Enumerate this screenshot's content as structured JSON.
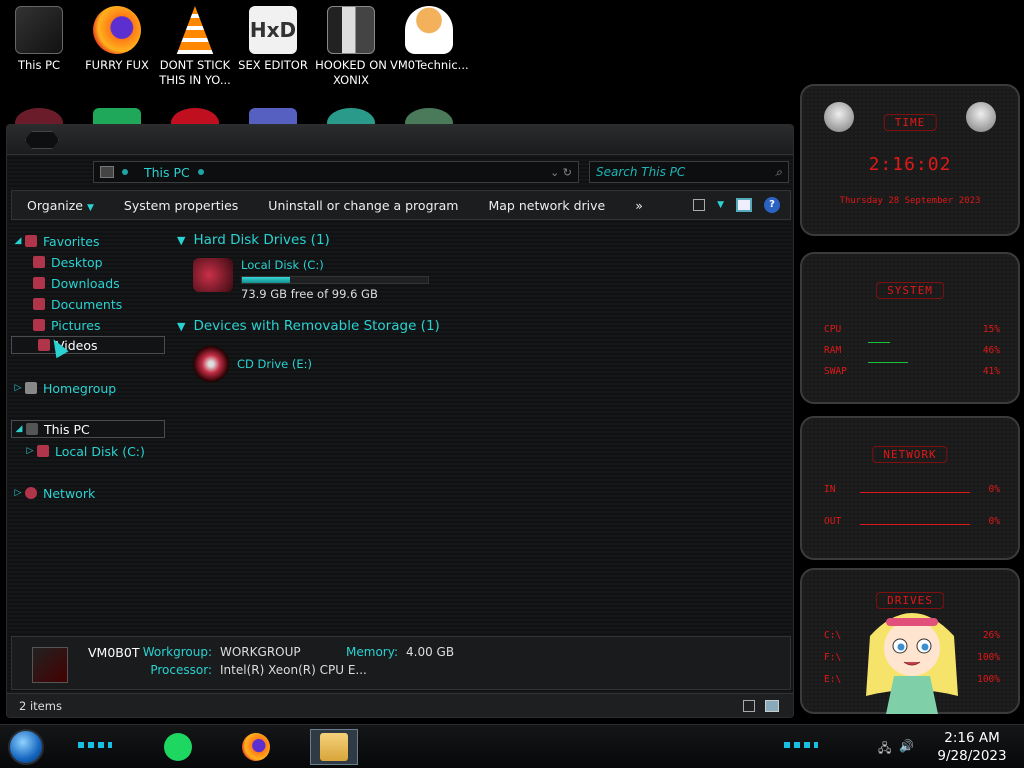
{
  "desktop_icons": [
    {
      "label": "This PC",
      "icon": "computer-icon"
    },
    {
      "label": "FURRY FUX",
      "icon": "firefox-icon"
    },
    {
      "label": "DONT STICK THIS IN YO...",
      "icon": "vlc-cone-icon"
    },
    {
      "label": "SEX EDITOR",
      "icon": "hxd-editor-icon"
    },
    {
      "label": "HOOKED ON XONIX",
      "icon": "xonix-game-icon"
    },
    {
      "label": "VM0Technic...",
      "icon": "technician-avatar-icon"
    }
  ],
  "explorer": {
    "address": "This PC",
    "search_placeholder": "Search This PC",
    "commands": {
      "organize": "Organize",
      "system_properties": "System properties",
      "uninstall": "Uninstall or change a program",
      "map_drive": "Map network drive",
      "more": "»"
    },
    "nav": {
      "favorites": "Favorites",
      "desktop": "Desktop",
      "downloads": "Downloads",
      "documents": "Documents",
      "pictures": "Pictures",
      "videos": "Videos",
      "homegroup": "Homegroup",
      "this_pc": "This PC",
      "local_disk": "Local Disk (C:)",
      "network": "Network"
    },
    "groups": {
      "hdd": "Hard Disk Drives (1)",
      "removable": "Devices with Removable Storage (1)"
    },
    "drives": {
      "c_name": "Local Disk (C:)",
      "c_free": "73.9 GB free of 99.6 GB",
      "c_used_fraction": 0.258,
      "e_name": "CD Drive (E:)"
    },
    "details": {
      "computer_name": "VM0B0T",
      "workgroup_label": "Workgroup:",
      "workgroup": "WORKGROUP",
      "memory_label": "Memory:",
      "memory": "4.00 GB",
      "processor_label": "Processor:",
      "processor": "Intel(R) Xeon(R) CPU E..."
    },
    "status": "2 items"
  },
  "gadgets": {
    "time": {
      "title": "TIME",
      "clock": "2:16:02",
      "date": "Thursday 28 September 2023"
    },
    "system": {
      "title": "SYSTEM",
      "rows": [
        {
          "label": "CPU",
          "value": "15%"
        },
        {
          "label": "RAM",
          "value": "46%"
        },
        {
          "label": "SWAP",
          "value": "41%"
        }
      ]
    },
    "network": {
      "title": "NETWORK",
      "rows": [
        {
          "label": "IN",
          "value": "0%"
        },
        {
          "label": "OUT",
          "value": "0%"
        }
      ]
    },
    "drives": {
      "title": "DRIVES",
      "rows": [
        {
          "label": "C:\\",
          "value": "26%"
        },
        {
          "label": "F:\\",
          "value": "100%"
        },
        {
          "label": "E:\\",
          "value": "100%"
        }
      ]
    }
  },
  "taskbar": {
    "time": "2:16 AM",
    "date": "9/28/2023",
    "accent": "#19bfe0"
  }
}
